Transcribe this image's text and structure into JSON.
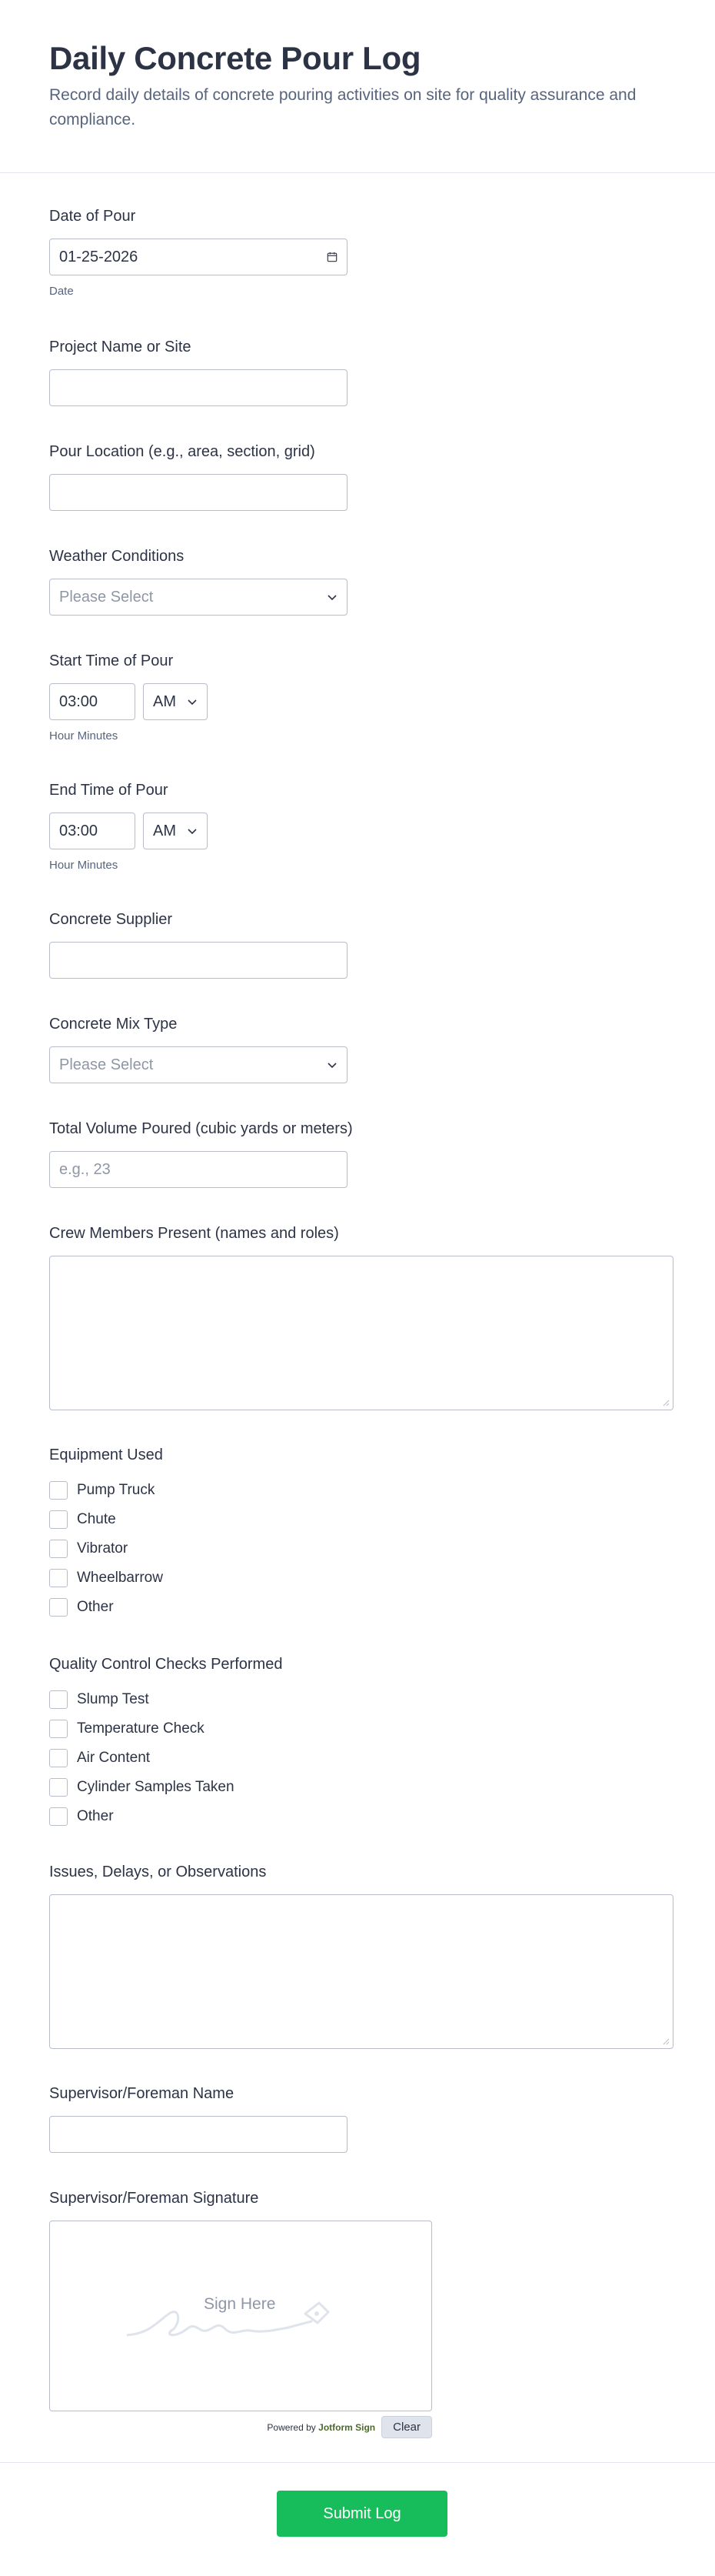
{
  "header": {
    "title": "Daily Concrete Pour Log",
    "description": "Record daily details of concrete pouring activities on site for quality assurance and compliance."
  },
  "date_of_pour": {
    "label": "Date of Pour",
    "value": "01-25-2026",
    "sublabel": "Date",
    "icon": "calendar-icon"
  },
  "project_name": {
    "label": "Project Name or Site",
    "value": ""
  },
  "pour_location": {
    "label": "Pour Location (e.g., area, section, grid)",
    "value": ""
  },
  "weather": {
    "label": "Weather Conditions",
    "placeholder": "Please Select"
  },
  "start_time": {
    "label": "Start Time of Pour",
    "value": "03:00",
    "ampm": "AM",
    "sublabel": "Hour Minutes"
  },
  "end_time": {
    "label": "End Time of Pour",
    "value": "03:00",
    "ampm": "AM",
    "sublabel": "Hour Minutes"
  },
  "supplier": {
    "label": "Concrete Supplier",
    "value": ""
  },
  "mix_type": {
    "label": "Concrete Mix Type",
    "placeholder": "Please Select"
  },
  "volume": {
    "label": "Total Volume Poured (cubic yards or meters)",
    "placeholder": "e.g., 23"
  },
  "crew": {
    "label": "Crew Members Present (names and roles)",
    "value": ""
  },
  "equipment": {
    "label": "Equipment Used",
    "options": [
      "Pump Truck",
      "Chute",
      "Vibrator",
      "Wheelbarrow",
      "Other"
    ]
  },
  "quality_checks": {
    "label": "Quality Control Checks Performed",
    "options": [
      "Slump Test",
      "Temperature Check",
      "Air Content",
      "Cylinder Samples Taken",
      "Other"
    ]
  },
  "issues": {
    "label": "Issues, Delays, or Observations",
    "value": ""
  },
  "supervisor_name": {
    "label": "Supervisor/Foreman Name",
    "value": ""
  },
  "signature": {
    "label": "Supervisor/Foreman Signature",
    "placeholder": "Sign Here",
    "powered_prefix": "Powered by",
    "powered_brand": "Jotform Sign",
    "clear_label": "Clear"
  },
  "submit_label": "Submit Log",
  "colors": {
    "accent": "#18bd5b",
    "border": "#b8bdc9",
    "text": "#2c3345",
    "muted": "#57647e"
  }
}
